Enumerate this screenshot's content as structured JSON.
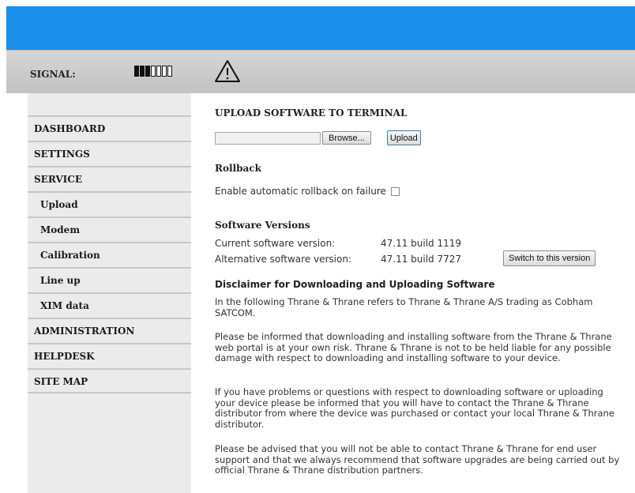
{
  "status": {
    "signal_label": "SIGNAL:",
    "signal_level": 3,
    "signal_max": 7,
    "warning_icon": "warning-triangle"
  },
  "sidebar": {
    "items": [
      {
        "label": "DASHBOARD",
        "sub": false
      },
      {
        "label": "SETTINGS",
        "sub": false
      },
      {
        "label": "SERVICE",
        "sub": false
      },
      {
        "label": "Upload",
        "sub": true
      },
      {
        "label": "Modem",
        "sub": true
      },
      {
        "label": "Calibration",
        "sub": true
      },
      {
        "label": "Line up",
        "sub": true
      },
      {
        "label": "XIM data",
        "sub": true
      },
      {
        "label": "ADMINISTRATION",
        "sub": false
      },
      {
        "label": "HELPDESK",
        "sub": false
      },
      {
        "label": "SITE MAP",
        "sub": false
      }
    ]
  },
  "upload": {
    "title": "UPLOAD SOFTWARE TO TERMINAL",
    "browse_label": "Browse...",
    "upload_label": "Upload"
  },
  "rollback": {
    "title": "Rollback",
    "checkbox_label": "Enable automatic rollback on failure"
  },
  "versions": {
    "title": "Software Versions",
    "current_label": "Current software version:",
    "current_value": "47.11 build 1119",
    "alternative_label": "Alternative software version:",
    "alternative_value": "47.11 build 7727",
    "switch_label": "Switch to this version"
  },
  "disclaimer": {
    "title": "Disclaimer for Downloading and Uploading Software",
    "paragraphs": [
      "In the following Thrane & Thrane refers to Thrane & Thrane A/S trading as Cobham SATCOM.",
      "Please be informed that downloading and installing software from the Thrane & Thrane web portal is at your own risk. Thrane & Thrane is not to be held liable for any possible damage with respect to downloading and installing software to your device.",
      "If you have problems or questions with respect to downloading software or uploading your device please be informed that you will have to contact the Thrane & Thrane distributor from where the device was purchased or contact your local Thrane & Thrane distributor.",
      "Please be advised that you will not be able to contact Thrane & Thrane for end user support and that we always recommend that software upgrades are being carried out by official Thrane & Thrane distribution partners."
    ]
  },
  "colors": {
    "topbar": "#1a8ee8",
    "statusbar": "#c8c8c8",
    "sidebar": "#ebebeb"
  }
}
